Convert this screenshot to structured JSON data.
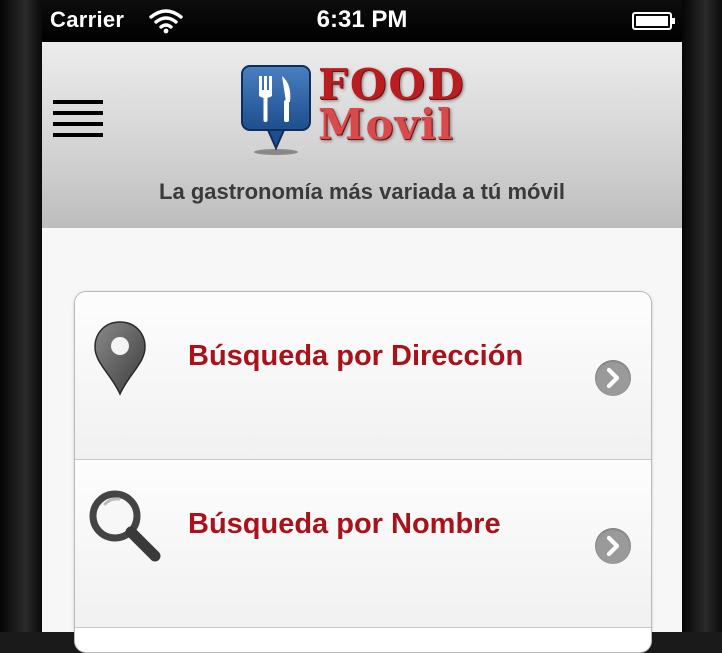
{
  "status_bar": {
    "carrier": "Carrier",
    "time": "6:31 PM",
    "icons": [
      "wifi-icon",
      "battery-icon"
    ]
  },
  "header": {
    "logo_line1": "FOOD",
    "logo_line2": "Movil",
    "tagline": "La gastronomía más variada a tú móvil",
    "menu_icon": "hamburger-menu-icon"
  },
  "menu": {
    "items": [
      {
        "label": "Búsqueda por Dirección",
        "icon": "map-pin-icon"
      },
      {
        "label": "Búsqueda por Nombre",
        "icon": "magnifier-icon"
      }
    ]
  },
  "colors": {
    "accent": "#a8121a",
    "logo_red": "#c0282a",
    "header_bg": "#d2d2d2",
    "arrow_gray": "#9a9a9a"
  }
}
